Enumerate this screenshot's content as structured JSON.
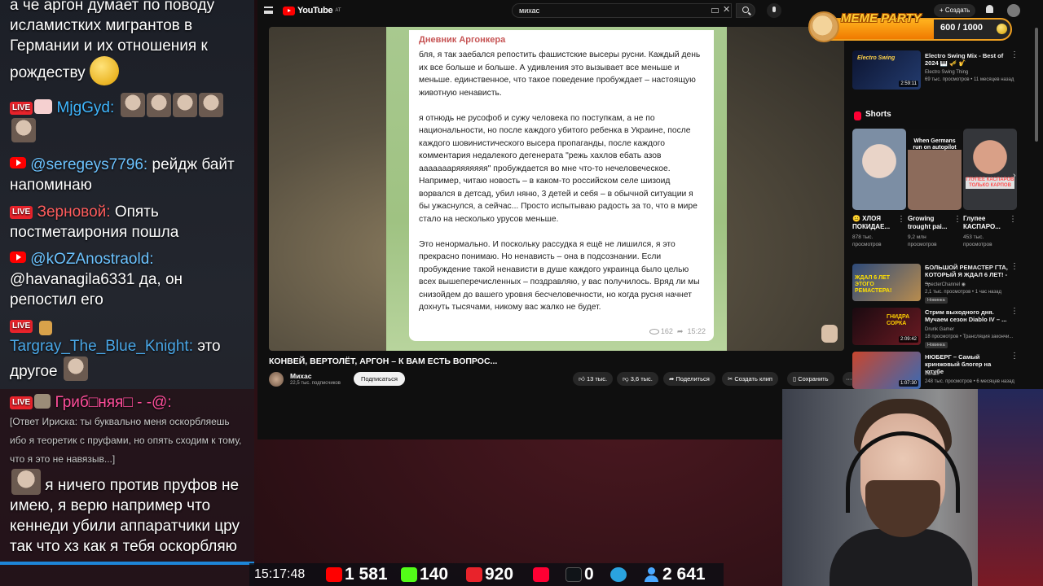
{
  "chat": {
    "messages": [
      {
        "text": "а че аргон думает по поводу исламистких мигрантов в Германии и их отношения к рождеству"
      },
      {
        "name": "MjgGyd:"
      },
      {
        "name": "@seregeys7796:",
        "text": "рейдж байт напоминаю"
      },
      {
        "name": "Зерновой:",
        "text": "Опять постметаирония пошла"
      },
      {
        "name": "@kOZAnostraold:",
        "text": "@havanagila6331 да, он репостил его"
      },
      {
        "name": "Targray_The_Blue_Knight:",
        "text": "это другое"
      },
      {
        "name": "Гриб□няя□ - -@:",
        "reply": "[Ответ Ириска: ты буквально меня оскорбляешь ибо я теоретик с пруфами, но опять сходим к тому, что я это не навязыв...]",
        "text": "я ничего против пруфов не имею, я верю например что кеннеди убили аппаратчики цру так что хз как я тебя оскорбляю"
      }
    ],
    "live_label": "LIVE"
  },
  "youtube": {
    "logo": "YouTube",
    "logo_cc": "AT",
    "search_value": "михас",
    "create_label": "+ Создать",
    "video": {
      "post_author": "Дневник Аргонкера",
      "post_paragraphs": [
        "бля, я так заебался репостить фашистские высеры русни. Каждый день их все больше и больше. А удивления это вызывает все меньше и меньше. единственное, что такое поведение пробуждает – настоящую животную ненависть.",
        "я отнюдь не русофоб и сужу человека по поступкам, а не по национальности, но после каждого убитого ребенка в Украине, после каждого шовинистического высера пропаганды, после каждого комментария недалекого дегенерата \"режь хахлов ебать азов аааааааряяяяяяя\" пробуждается во мне что-то нечеловеческое. Например, читаю новость – в каком-то российском селе шизоид ворвался в детсад, убил няню, 3 детей и себя – в обычной ситуации я бы ужаснулся, а сейчас... Просто испытываю радость за то, что в мире стало на несколько урусов меньше.",
        "Это ненормально. И поскольку рассудка я ещё не лишился, я это прекрасно понимаю. Но ненависть – она в подсознании. Если пробуждение такой ненависти в душе каждого украинца было целью всех вышеперечисленных – поздравляю, у вас получилось. Вряд ли мы снизойдем до вашего уровня бесчеловечности, но когда русня начнет дохнуть тысячами, никому вас жалко не будет."
      ],
      "post_views": "162",
      "post_time": "15:22",
      "title": "КОНВЕЙ, ВЕРТОЛЁТ, АРГОН – К ВАМ ЕСТЬ ВОПРОС...",
      "channel": "Михас",
      "subs": "22,5 тыс. подписчиков",
      "subscribe": "Подписаться",
      "likes": "13 тыс.",
      "dislikes": "3,6 тыс.",
      "share": "Поделиться",
      "clip": "Создать клип",
      "save": "Сохранить"
    },
    "recommended_top": {
      "title": "Electro Swing Mix - Best of 2024 🎹 🎺 🎷",
      "channel": "Electro Swing Thing",
      "meta": "69 тыс. просмотров • 11 месяцев назад",
      "duration": "2:59:11",
      "thumb_text": "Electro Swing"
    },
    "shorts_label": "Shorts",
    "shorts": [
      {
        "title": "😐 ХЛОЯ ПОКИДАЕ...",
        "meta1": "878 тыс.",
        "meta2": "просмотров",
        "thumb_text": ""
      },
      {
        "title": "Growing trought pai...",
        "meta1": "9,2 млн",
        "meta2": "просмотров",
        "thumb_text": "When Germans run on autopilot"
      },
      {
        "title": "Глупее КАСПАРО...",
        "meta1": "453 тыс.",
        "meta2": "просмотров",
        "thumb_text": "ГЛУПЕЕ КАСПАРОВ ТОЛЬКО КАРПОВ"
      }
    ],
    "recommended": [
      {
        "title": "БОЛЬШОЙ РЕМАСТЕР ГТА, КОТОРЫЙ Я ЖДАЛ 6 ЛЕТ! - ...",
        "channel": "SpecterChannel ◉",
        "meta": "2,1 тыс. просмотров • 1 час назад",
        "badge": "Новинка",
        "thumb_text": "ЖДАЛ 6 ЛЕТ ЭТОГО РЕМАСТЕРА!"
      },
      {
        "title": "Стрим выходного дня. Мучаем сезон Diablo IV – ...",
        "channel": "Drunk Gamer",
        "meta": "18 просмотров • Трансляция закончи...",
        "badge": "Новинка",
        "duration": "2:09:42",
        "thumb_text": "ГНИДРА СОРКА"
      },
      {
        "title": "НЮБЕРГ – Самый кринжовый блогер на ютубе",
        "channel": "Михас",
        "meta": "248 тыс. просмотров • 6 месяцев назад",
        "duration": "1:07:30",
        "thumb_text": ""
      }
    ]
  },
  "meme_party": {
    "title": "MEME PARTY",
    "count": "600 / 1000",
    "progress": 0.6
  },
  "stats": {
    "time": "15:17:48",
    "youtube": "1 581",
    "kick": "140",
    "vklive": "920",
    "rutube": "0",
    "telegram": "",
    "viewers": "2 641"
  }
}
